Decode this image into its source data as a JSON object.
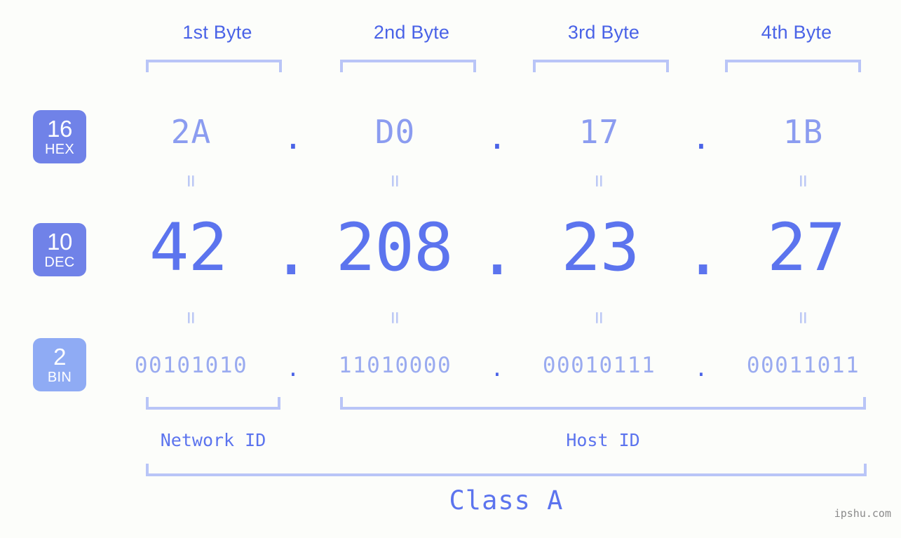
{
  "background_color": "#fcfdfa",
  "accent_colors": {
    "header_blue": "#4a63e7",
    "badge_strong": "#7082e8",
    "badge_light": "#8fabf4",
    "hex_text": "#8b9cf0",
    "dec_text": "#5c74ee",
    "bin_text": "#9aabf0",
    "bracket": "#b9c5f7",
    "equals": "#bcc8f5",
    "watermark": "#8a8a8a"
  },
  "byte_headers": [
    {
      "label": "1st Byte"
    },
    {
      "label": "2nd Byte"
    },
    {
      "label": "3rd Byte"
    },
    {
      "label": "4th Byte"
    }
  ],
  "rows": {
    "hex": {
      "badge_number": "16",
      "badge_system": "HEX",
      "values": [
        "2A",
        "D0",
        "17",
        "1B"
      ],
      "separator": "."
    },
    "dec": {
      "badge_number": "10",
      "badge_system": "DEC",
      "values": [
        "42",
        "208",
        "23",
        "27"
      ],
      "separator": "."
    },
    "bin": {
      "badge_number": "2",
      "badge_system": "BIN",
      "values": [
        "00101010",
        "11010000",
        "00010111",
        "00011011"
      ],
      "separator": "."
    }
  },
  "equals_mark": "=",
  "sections": {
    "network_id": "Network ID",
    "host_id": "Host ID",
    "class": "Class A"
  },
  "watermark": "ipshu.com"
}
